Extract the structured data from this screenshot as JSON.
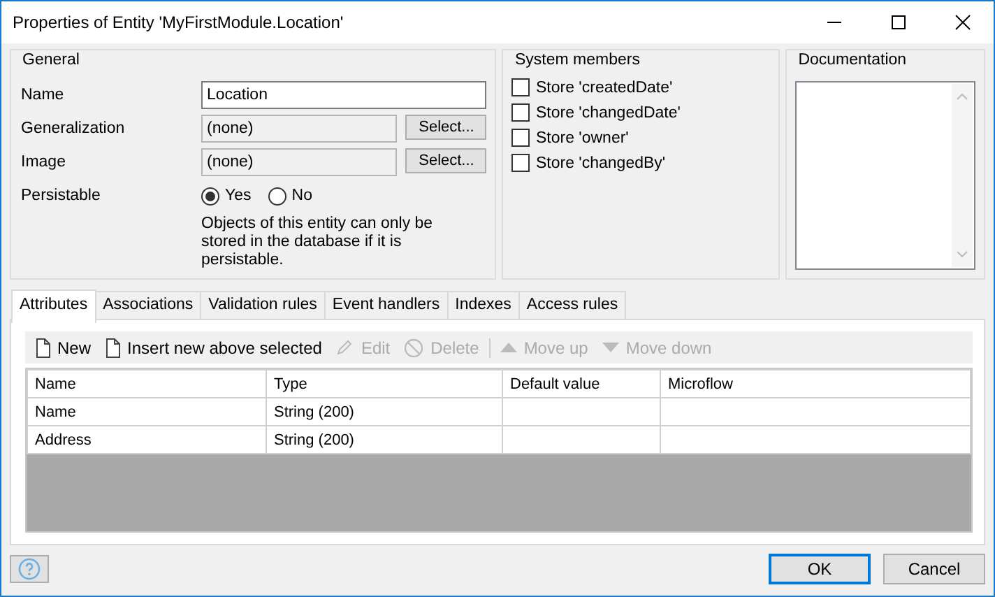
{
  "window": {
    "title": "Properties of Entity 'MyFirstModule.Location'"
  },
  "general": {
    "title": "General",
    "name": {
      "label": "Name",
      "value": "Location"
    },
    "generalization": {
      "label": "Generalization",
      "value": "(none)",
      "button": "Select..."
    },
    "image": {
      "label": "Image",
      "value": "(none)",
      "button": "Select..."
    },
    "persistable": {
      "label": "Persistable",
      "options": [
        {
          "label": "Yes",
          "selected": true
        },
        {
          "label": "No",
          "selected": false
        }
      ],
      "note": "Objects of this entity can only be stored in the database if it is persistable."
    }
  },
  "system_members": {
    "title": "System members",
    "items": [
      {
        "label": "Store 'createdDate'",
        "checked": false
      },
      {
        "label": "Store 'changedDate'",
        "checked": false
      },
      {
        "label": "Store 'owner'",
        "checked": false
      },
      {
        "label": "Store 'changedBy'",
        "checked": false
      }
    ]
  },
  "documentation": {
    "title": "Documentation"
  },
  "tabs": [
    {
      "label": "Attributes",
      "selected": true
    },
    {
      "label": "Associations",
      "selected": false
    },
    {
      "label": "Validation rules",
      "selected": false
    },
    {
      "label": "Event handlers",
      "selected": false
    },
    {
      "label": "Indexes",
      "selected": false
    },
    {
      "label": "Access rules",
      "selected": false
    }
  ],
  "toolbar": [
    {
      "label": "New",
      "kind": "new",
      "disabled": false
    },
    {
      "label": "Insert new above selected",
      "kind": "insert",
      "disabled": false
    },
    {
      "label": "Edit",
      "kind": "edit",
      "disabled": true
    },
    {
      "label": "Delete",
      "kind": "delete",
      "disabled": true
    },
    {
      "label": "Move up",
      "kind": "up",
      "disabled": true,
      "separator_before": true
    },
    {
      "label": "Move down",
      "kind": "down",
      "disabled": true
    }
  ],
  "table": {
    "columns": [
      "Name",
      "Type",
      "Default value",
      "Microflow"
    ],
    "rows": [
      [
        "Name",
        "String (200)",
        "",
        ""
      ],
      [
        "Address",
        "String (200)",
        "",
        ""
      ]
    ]
  },
  "buttons": [
    {
      "label": "OK",
      "default": true
    },
    {
      "label": "Cancel",
      "default": false
    }
  ]
}
